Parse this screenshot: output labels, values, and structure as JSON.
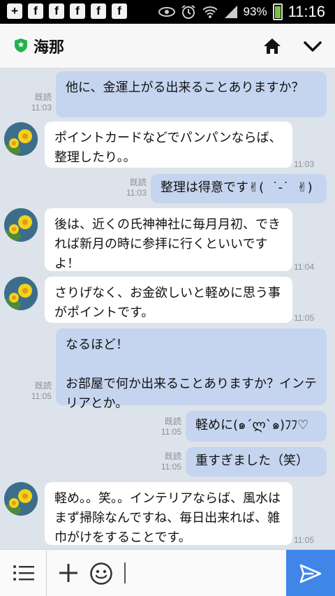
{
  "status_bar": {
    "notification_icons": [
      "+",
      "f",
      "f",
      "f",
      "f",
      "f"
    ],
    "battery_percent": "93%",
    "time": "11:16"
  },
  "header": {
    "title": "海那"
  },
  "messages": [
    {
      "dir": "out",
      "text": "他に、金運上がる出来ることありますか？",
      "read": "既読",
      "time": "11:03"
    },
    {
      "dir": "in",
      "text": "ポイントカードなどでパンパンならば、整理したり。。",
      "time": "11:03"
    },
    {
      "dir": "out",
      "text": "整理は得意です✌(  ˙-˙  ✌)",
      "read": "既読",
      "time": "11:03"
    },
    {
      "dir": "in",
      "text": "後は、近くの氏神神社に毎月月初、できれば新月の時に参拝に行くといいですよ！",
      "time": "11:04"
    },
    {
      "dir": "in",
      "text": "さりげなく、お金欲しいと軽めに思う事がポイントです。",
      "time": "11:05"
    },
    {
      "dir": "out",
      "text": "なるほど！\n\nお部屋で何か出来ることありますか？インテリアとか。",
      "read": "既読",
      "time": "11:05"
    },
    {
      "dir": "out",
      "text": "軽めに(๑´ლ`๑)ﾌﾌ♡",
      "read": "既読",
      "time": "11:05"
    },
    {
      "dir": "out",
      "text": "重すぎました（笑）",
      "read": "既読",
      "time": "11:05"
    },
    {
      "dir": "in",
      "text": "軽め。。笑。。インテリアならば、風水はまず掃除なんですね、毎日出来れば、雑巾がけをすることです。",
      "time": "11:05"
    }
  ],
  "colors": {
    "chat_background": "#dde3ea",
    "outgoing_bubble": "#c5d5ef",
    "incoming_bubble": "#ffffff",
    "send_button": "#3f86e8",
    "friend_shield": "#22b24c"
  },
  "icons": {
    "friend_badge": "shield-star-icon",
    "home": "home-icon",
    "collapse": "chevron-down-icon",
    "menu": "menu-list-icon",
    "add": "plus-icon",
    "sticker": "smiley-icon",
    "send": "send-icon"
  }
}
